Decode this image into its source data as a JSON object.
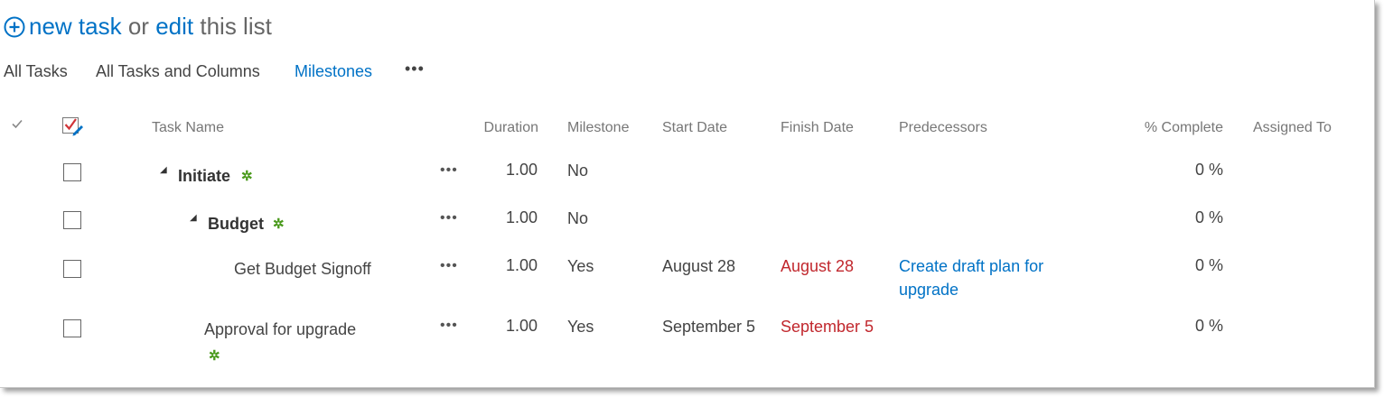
{
  "header": {
    "new_task_label": "new task",
    "or_label": "or",
    "edit_label": "edit",
    "this_list_label": "this list"
  },
  "views": {
    "items": [
      "All Tasks",
      "All Tasks and Columns",
      "Milestones"
    ],
    "selected": "Milestones",
    "more_label": "•••"
  },
  "columns": [
    "Task Name",
    "Duration",
    "Milestone",
    "Start Date",
    "Finish Date",
    "Predecessors",
    "% Complete",
    "Assigned To"
  ],
  "rows": [
    {
      "task_name": "Initiate",
      "duration": "1.00",
      "milestone": "No",
      "start_date": "",
      "finish_date": "",
      "predecessors": "",
      "percent_complete": "0 %",
      "assigned_to": "",
      "is_summary": true,
      "is_new": true
    },
    {
      "task_name": "Budget",
      "duration": "1.00",
      "milestone": "No",
      "start_date": "",
      "finish_date": "",
      "predecessors": "",
      "percent_complete": "0 %",
      "assigned_to": "",
      "is_summary": true,
      "is_new": true
    },
    {
      "task_name": "Get Budget Signoff",
      "duration": "1.00",
      "milestone": "Yes",
      "start_date": "August 28",
      "finish_date": "August 28",
      "predecessors": "Create draft plan for upgrade",
      "percent_complete": "0 %",
      "assigned_to": "",
      "is_summary": false,
      "is_new": false
    },
    {
      "task_name": "Approval for upgrade",
      "duration": "1.00",
      "milestone": "Yes",
      "start_date": "September 5",
      "finish_date": "September 5",
      "predecessors": "",
      "percent_complete": "0 %",
      "assigned_to": "",
      "is_summary": false,
      "is_new": true
    }
  ],
  "row_menu_label": "•••",
  "new_item_glyph": "✲",
  "colors": {
    "link": "#0072c6",
    "overdue": "#c1272d",
    "new_icon": "#4a9a1c"
  },
  "icons": [
    "add-circle-icon",
    "checkmark-icon",
    "select-all-icon",
    "collapse-triangle-icon",
    "new-item-icon",
    "ellipsis-icon"
  ]
}
